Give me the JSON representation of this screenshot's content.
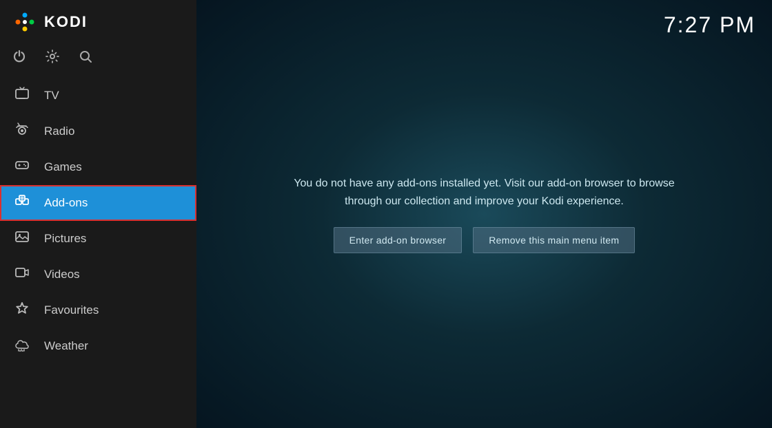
{
  "app": {
    "title": "KODI",
    "time": "7:27 PM"
  },
  "sidebar": {
    "controls": [
      {
        "name": "power-icon",
        "symbol": "⏻"
      },
      {
        "name": "settings-icon",
        "symbol": "⚙"
      },
      {
        "name": "search-icon",
        "symbol": "🔍"
      }
    ],
    "nav_items": [
      {
        "id": "tv",
        "label": "TV",
        "icon": "tv",
        "active": false
      },
      {
        "id": "radio",
        "label": "Radio",
        "icon": "radio",
        "active": false
      },
      {
        "id": "games",
        "label": "Games",
        "icon": "games",
        "active": false
      },
      {
        "id": "addons",
        "label": "Add-ons",
        "icon": "addons",
        "active": true
      },
      {
        "id": "pictures",
        "label": "Pictures",
        "icon": "pictures",
        "active": false
      },
      {
        "id": "videos",
        "label": "Videos",
        "icon": "videos",
        "active": false
      },
      {
        "id": "favourites",
        "label": "Favourites",
        "icon": "favourites",
        "active": false
      },
      {
        "id": "weather",
        "label": "Weather",
        "icon": "weather",
        "active": false
      }
    ]
  },
  "main": {
    "message": "You do not have any add-ons installed yet. Visit our add-on browser to browse through our collection and improve your Kodi experience.",
    "buttons": [
      {
        "id": "enter-browser",
        "label": "Enter add-on browser"
      },
      {
        "id": "remove-menu-item",
        "label": "Remove this main menu item"
      }
    ]
  }
}
